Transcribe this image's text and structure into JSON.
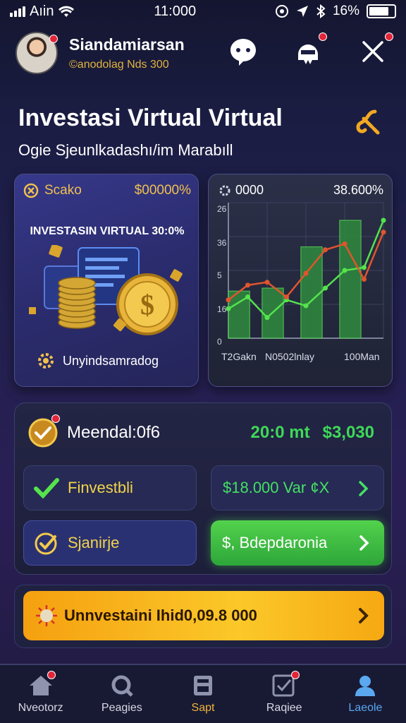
{
  "status": {
    "carrier": "Aıin",
    "time": "11:000",
    "battery": "16%"
  },
  "header": {
    "user_name": "Siandamiarsan",
    "user_sub": "©anodolag Nds 300"
  },
  "page": {
    "title": "Investasi Virtual Virtual",
    "subtitle": "Ogie Sjeunlkadashı/im Marabıll"
  },
  "card1": {
    "left_label": "Scako",
    "right_value": "$00000%",
    "banner": "INVESTASIN VIRTUAL 30:0%",
    "footer": "Unyindsamradog"
  },
  "card2": {
    "left_label": "0000",
    "right_value": "38.600%",
    "y_ticks": [
      "0",
      "16",
      "5",
      "36",
      "26"
    ],
    "x_ticks": [
      "T2Gakn",
      "N0502lnlay",
      "100Man"
    ]
  },
  "chart_data": {
    "type": "line",
    "x": [
      0,
      1,
      2,
      3,
      4,
      5,
      6,
      7,
      8
    ],
    "series": [
      {
        "color": "#55e34d",
        "values": [
          10,
          14,
          7,
          13,
          11,
          17,
          23,
          24,
          40
        ]
      },
      {
        "color": "#e0552e",
        "values": [
          13,
          18,
          19,
          14,
          22,
          30,
          32,
          20,
          36
        ]
      }
    ],
    "bars": [
      {
        "x": 0,
        "value": 16
      },
      {
        "x": 2,
        "value": 17
      },
      {
        "x": 4,
        "value": 31
      },
      {
        "x": 6,
        "value": 40
      }
    ],
    "ylim": [
      0,
      46
    ],
    "x_tick_labels": [
      "T2Gakn",
      "N0502lnlay",
      "100Man"
    ],
    "grid": true
  },
  "panel": {
    "title": "Meendal:0f6",
    "value1": "20:0 mt",
    "value2": "$3,030",
    "btn1": "Finvestbli",
    "btn2": "$18.000 Var ¢X",
    "btn3": "Sjanirje",
    "btn4": "$, Bdepdaronia"
  },
  "cta": {
    "label": "Unnvestaini Ihid0,09.8 000"
  },
  "tabs": [
    {
      "label": "Nveotorz",
      "color": "#d7d9e6"
    },
    {
      "label": "Peagies",
      "color": "#d7d9e6"
    },
    {
      "label": "Sapt",
      "color": "#f0b43a"
    },
    {
      "label": "Raqiee",
      "color": "#d7d9e6"
    },
    {
      "label": "Laeole",
      "color": "#5aa8f0"
    }
  ],
  "colors": {
    "accent": "#3ed957",
    "gold": "#f2c94c",
    "badge": "#e3253a"
  }
}
